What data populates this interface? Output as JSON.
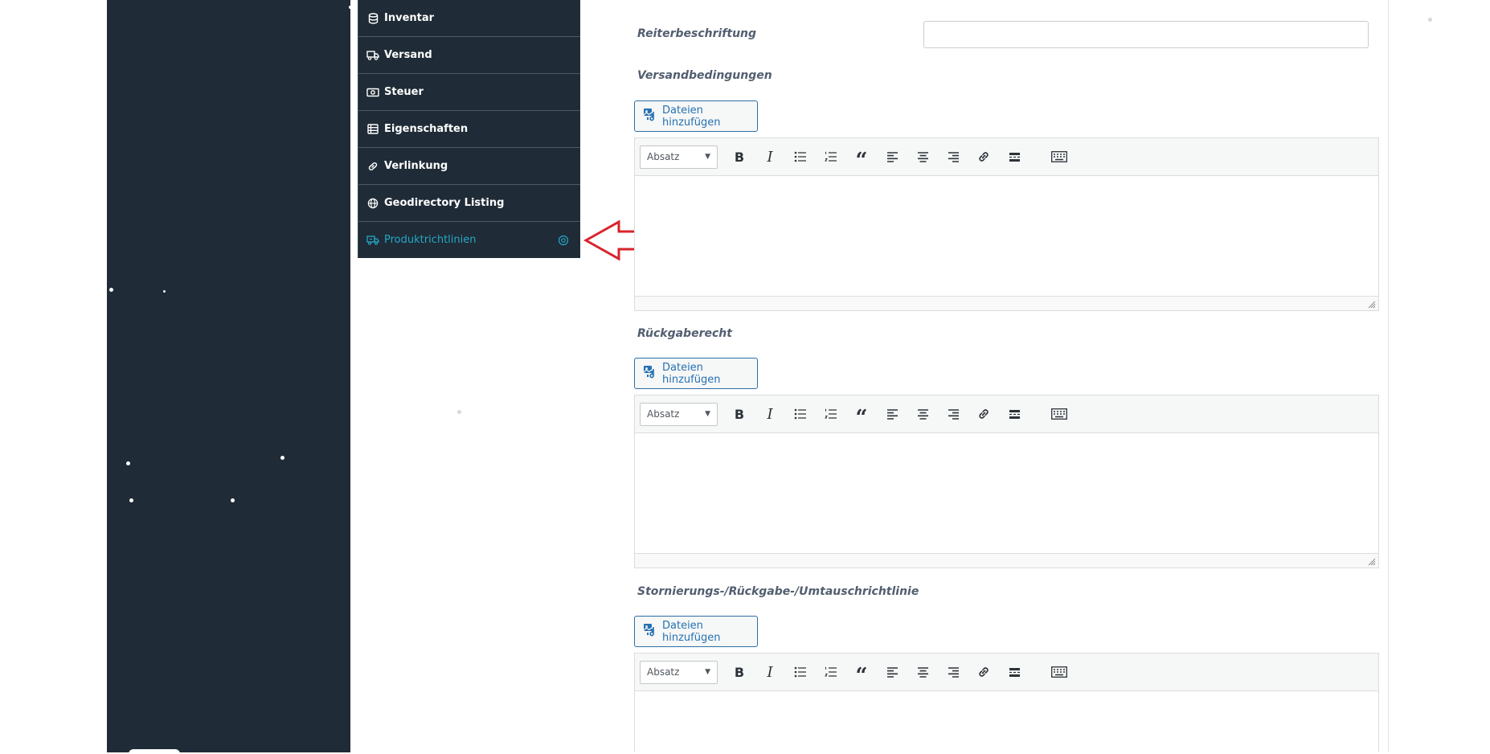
{
  "sidebar_tabs": [
    {
      "label": "Inventar",
      "icon": "database-icon"
    },
    {
      "label": "Versand",
      "icon": "truck-icon"
    },
    {
      "label": "Steuer",
      "icon": "money-icon"
    },
    {
      "label": "Eigenschaften",
      "icon": "list-icon"
    },
    {
      "label": "Verlinkung",
      "icon": "link-icon"
    },
    {
      "label": "Geodirectory Listing",
      "icon": "globe-icon"
    },
    {
      "label": "Produktrichtlinien",
      "icon": "shipping-policy-icon",
      "active": true
    }
  ],
  "colors": {
    "dark": "#1f2b36",
    "active_tab": "#25a8c6",
    "arrow": "#d9232b",
    "button_text": "#2571b1",
    "label": "#525e70"
  },
  "fields": {
    "tab_title_label": "Reiterbeschriftung",
    "tab_title_value": "",
    "sections": [
      {
        "label": "Versandbedingungen",
        "add_files": "Dateien hinzufügen",
        "format": "Absatz"
      },
      {
        "label": "Rückgaberecht",
        "add_files": "Dateien hinzufügen",
        "format": "Absatz"
      },
      {
        "label": "Stornierungs-/Rückgabe-/Umtauschrichtlinie",
        "add_files": "Dateien hinzufügen",
        "format": "Absatz"
      }
    ]
  },
  "toolbar_icons": [
    "bold-icon",
    "italic-icon",
    "bullet-list-icon",
    "numbered-list-icon",
    "blockquote-icon",
    "align-left-icon",
    "align-center-icon",
    "align-right-icon",
    "link-icon",
    "read-more-icon",
    "toolbar-toggle-icon"
  ]
}
